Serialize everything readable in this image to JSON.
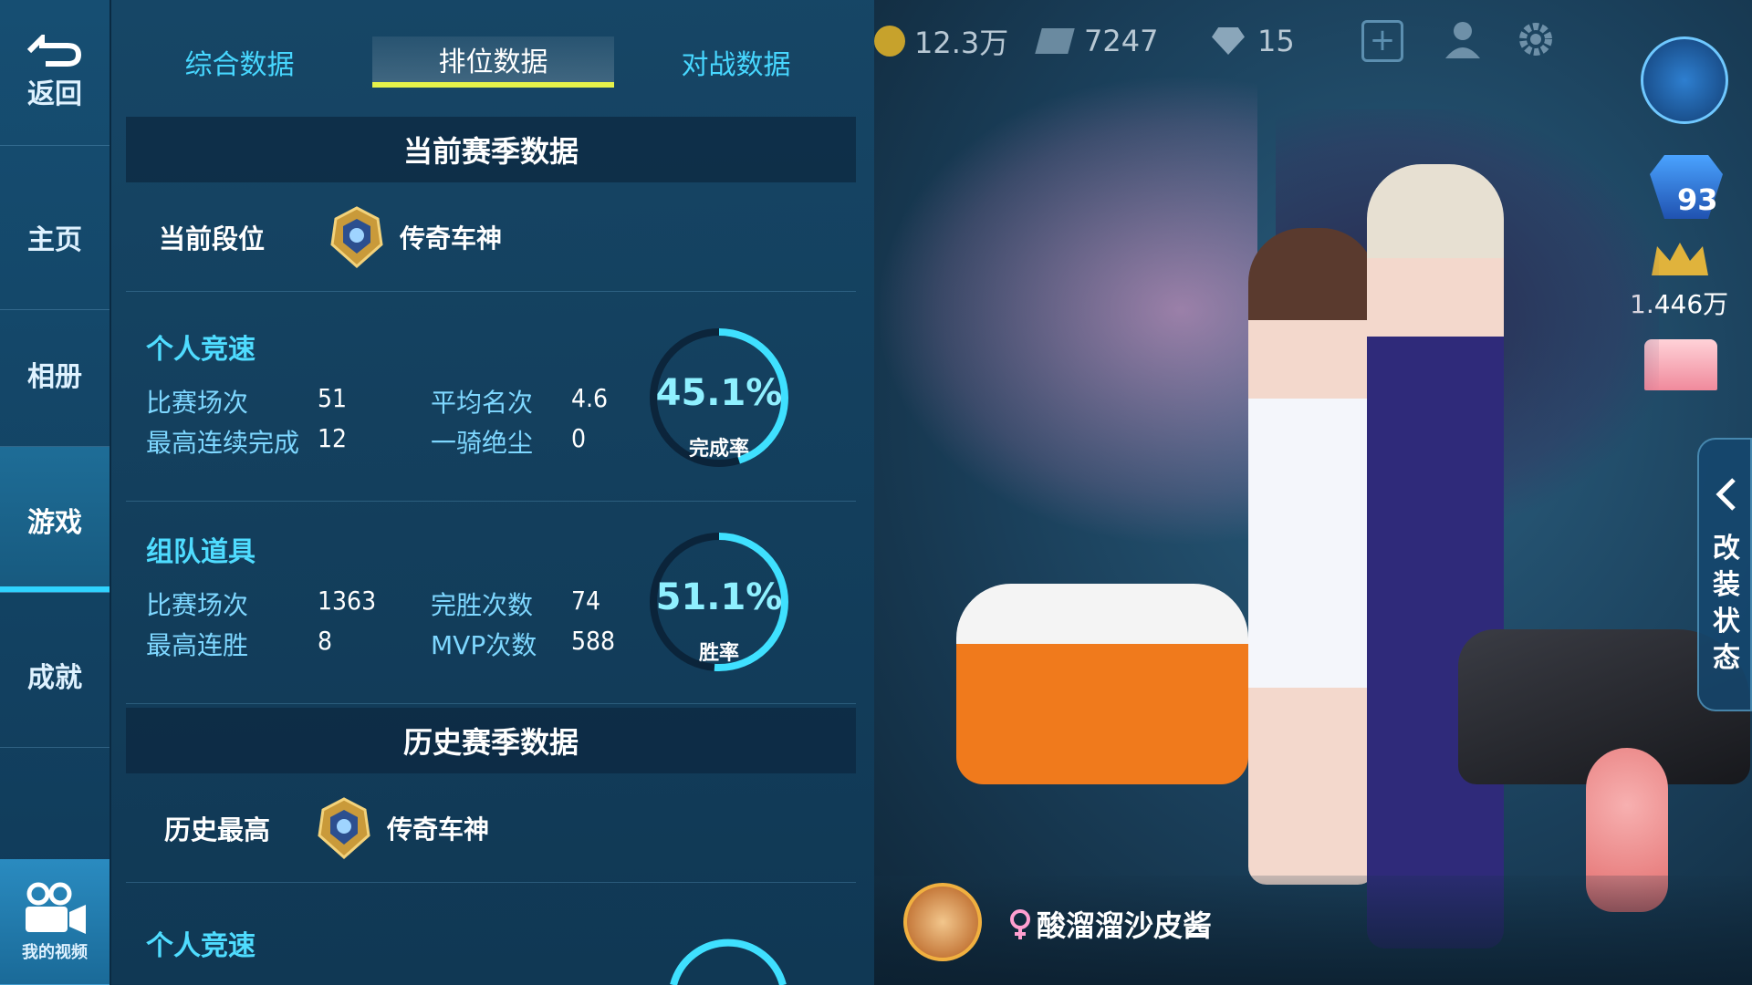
{
  "nav": {
    "back_label": "返回",
    "items": [
      {
        "label": "主页"
      },
      {
        "label": "相册"
      },
      {
        "label": "游戏"
      },
      {
        "label": "成就"
      }
    ],
    "video_label": "我的视频"
  },
  "tabs": [
    {
      "label": "综合数据"
    },
    {
      "label": "排位数据"
    },
    {
      "label": "对战数据"
    }
  ],
  "current_season": {
    "header": "当前赛季数据",
    "rank_label": "当前段位",
    "rank_name": "传奇车神",
    "solo": {
      "title": "个人竞速",
      "matches_label": "比赛场次",
      "matches": "51",
      "avg_rank_label": "平均名次",
      "avg_rank": "4.6",
      "streak_label": "最高连续完成",
      "streak": "12",
      "wins_label": "一骑绝尘",
      "wins": "0",
      "rate": "45.1%",
      "rate_fraction": 0.451,
      "rate_label": "完成率"
    },
    "team": {
      "title": "组队道具",
      "matches_label": "比赛场次",
      "matches": "1363",
      "perfect_label": "完胜次数",
      "perfect": "74",
      "streak_label": "最高连胜",
      "streak": "8",
      "mvp_label": "MVP次数",
      "mvp": "588",
      "rate": "51.1%",
      "rate_fraction": 0.511,
      "rate_label": "胜率"
    }
  },
  "history": {
    "header": "历史赛季数据",
    "rank_label": "历史最高",
    "rank_name": "传奇车神",
    "solo_title": "个人竞速"
  },
  "topbar": {
    "coins": "12.3万",
    "cards": "7247",
    "gems": "15"
  },
  "right": {
    "level": "93",
    "popularity": "1.446万",
    "side_tab_label": "改装状态",
    "player_name": "酸溜溜沙皮酱"
  },
  "colors": {
    "accent": "#2fd3ff",
    "tab_underline": "#e6f24a",
    "ring": "#3fe0ff"
  }
}
